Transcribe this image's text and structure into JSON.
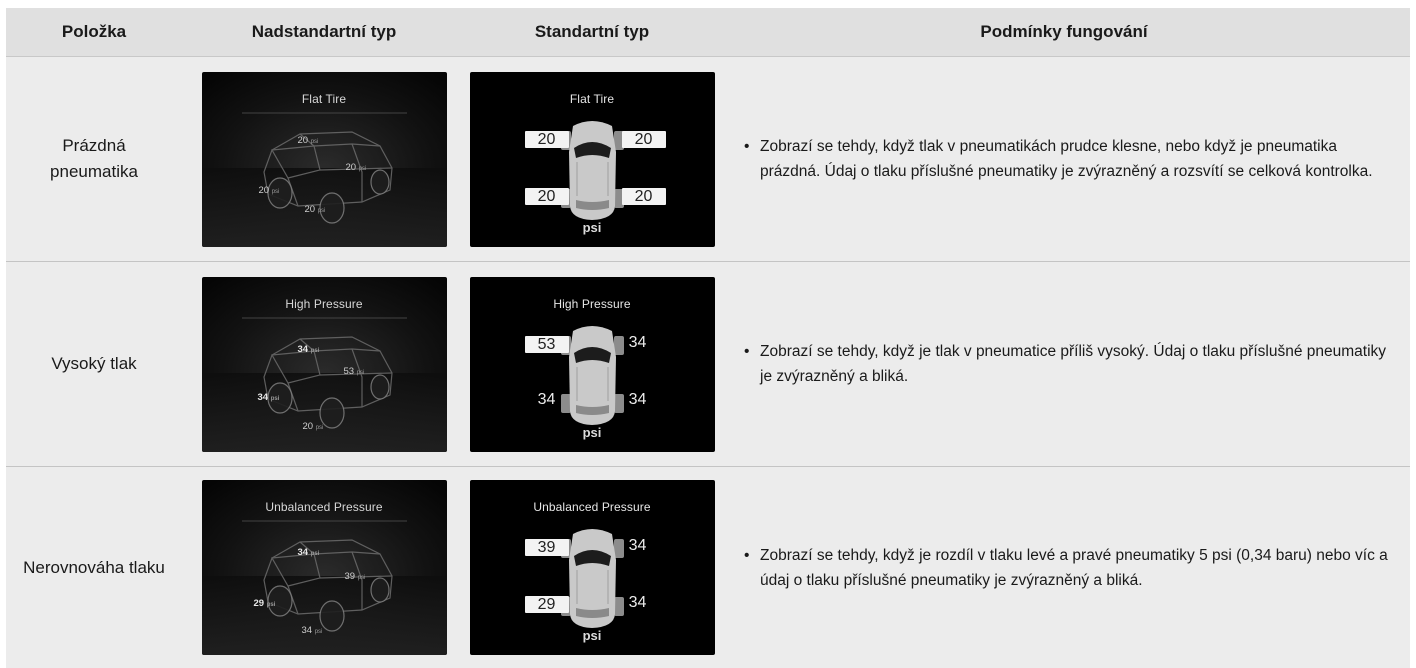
{
  "headers": {
    "item": "Položka",
    "premium": "Nadstandartní typ",
    "standard": "Standartní typ",
    "conditions": "Podmínky fungování"
  },
  "psi_unit": "psi",
  "rows": [
    {
      "item": "Prázdná pneumatika",
      "premium": {
        "title": "Flat Tire",
        "fl": "20",
        "fr": "20",
        "rl": "20",
        "rr": "20"
      },
      "standard": {
        "title": "Flat Tire",
        "fl": "20",
        "fr": "20",
        "rl": "20",
        "rr": "20",
        "highlighted": [
          "fl",
          "fr",
          "rl",
          "rr"
        ]
      },
      "condition": "Zobrazí se tehdy, když tlak v pneumatikách prudce klesne, nebo když je pneumatika prázdná. Údaj o tlaku příslušné pneumatiky je zvýrazněný a rozsvítí se celková kontrolka."
    },
    {
      "item": "Vysoký tlak",
      "premium": {
        "title": "High Pressure",
        "fl": "34",
        "fr": "53",
        "rl": "34",
        "rr": "20"
      },
      "standard": {
        "title": "High Pressure",
        "fl": "53",
        "fr": "34",
        "rl": "34",
        "rr": "34",
        "highlighted": [
          "fl"
        ]
      },
      "condition": "Zobrazí se tehdy, když je tlak v pneumatice příliš vysoký. Údaj o tlaku příslušné pneumatiky je zvýrazněný a bliká."
    },
    {
      "item": "Nerovnováha tlaku",
      "premium": {
        "title": "Unbalanced Pressure",
        "fl": "34",
        "fr": "39",
        "rl": "29",
        "rr": "34"
      },
      "standard": {
        "title": "Unbalanced Pressure",
        "fl": "39",
        "fr": "34",
        "rl": "29",
        "rr": "34",
        "highlighted": [
          "fl",
          "rl"
        ]
      },
      "condition": "Zobrazí se tehdy, když je rozdíl v tlaku levé a pravé pneumatiky 5 psi (0,34 baru) nebo víc a údaj o tlaku příslušné pneumatiky je zvýrazněný a bliká."
    }
  ],
  "colors": {
    "header_bg": "#e0e0e0",
    "row_bg": "#ececec",
    "panel_bg": "#000000",
    "highlight_box": "#f3f3f3"
  }
}
